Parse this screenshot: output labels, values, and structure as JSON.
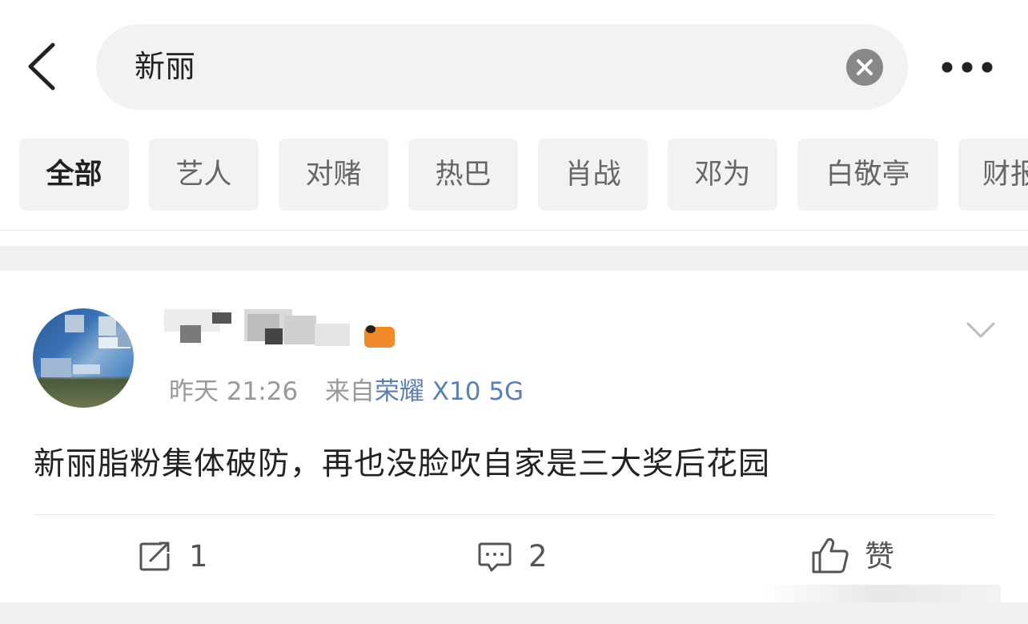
{
  "search": {
    "query": "新丽",
    "back_icon": "chevron-left-icon",
    "clear_icon": "close-circle-icon",
    "more_icon": "more-horizontal-icon"
  },
  "tabs": [
    {
      "label": "全部",
      "active": true
    },
    {
      "label": "艺人",
      "active": false
    },
    {
      "label": "对赌",
      "active": false
    },
    {
      "label": "热巴",
      "active": false
    },
    {
      "label": "肖战",
      "active": false
    },
    {
      "label": "邓为",
      "active": false
    },
    {
      "label": "白敬亭",
      "active": false
    },
    {
      "label": "财报",
      "active": false
    }
  ],
  "post": {
    "time": "昨天 21:26",
    "source_prefix": "来自",
    "device": "荣耀 X10 5G",
    "text": "新丽脂粉集体破防，再也没脸吹自家是三大奖后花园",
    "menu_icon": "chevron-down-icon",
    "actions": {
      "repost_count": "1",
      "comment_count": "2",
      "like_label": "赞"
    }
  },
  "colors": {
    "link_blue": "#5b7fae",
    "chip_bg": "#f2f2f2",
    "muted_text": "#999999"
  }
}
